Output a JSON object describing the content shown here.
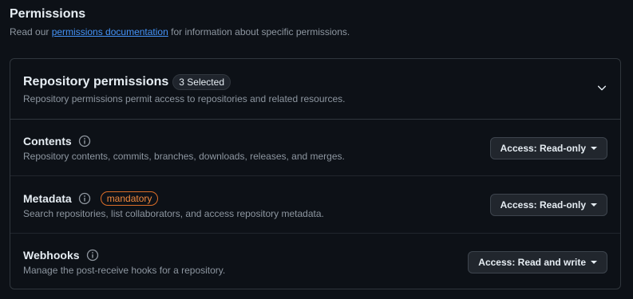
{
  "section": {
    "title": "Permissions",
    "desc_prefix": "Read our ",
    "doc_link": "permissions documentation",
    "desc_suffix": " for information about specific permissions."
  },
  "repository_permissions": {
    "heading": "Repository permissions",
    "selected_count": "3 Selected",
    "description": "Repository permissions permit access to repositories and related resources.",
    "expand_icon": "chevron-down-icon"
  },
  "permissions": [
    {
      "title": "Contents",
      "description": "Repository contents, commits, branches, downloads, releases, and merges.",
      "access": "Access: Read-only",
      "mandatory": ""
    },
    {
      "title": "Metadata",
      "description": "Search repositories, list collaborators, and access repository metadata.",
      "access": "Access: Read-only",
      "mandatory": "mandatory"
    },
    {
      "title": "Webhooks",
      "description": "Manage the post-receive hooks for a repository.",
      "access": "Access: Read and write",
      "mandatory": ""
    }
  ],
  "colors": {
    "background": "#0d1117",
    "border": "#30363d",
    "link": "#4493f8",
    "muted_text": "#8d96a0",
    "mandatory": "#f0883e"
  }
}
